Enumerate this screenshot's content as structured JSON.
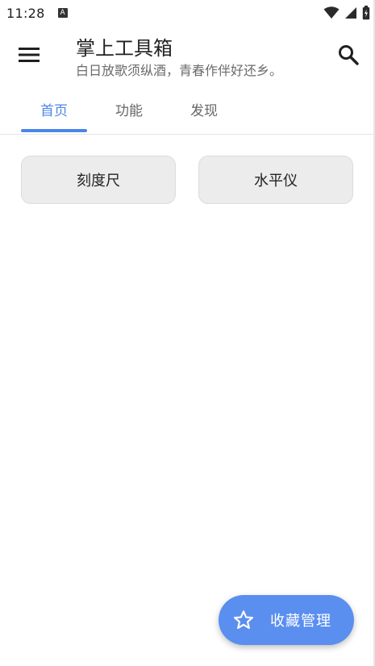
{
  "status_bar": {
    "time": "11:28",
    "notification_glyph": "A"
  },
  "toolbar": {
    "title": "掌上工具箱",
    "subtitle": "白日放歌须纵酒，青春作伴好还乡。",
    "menu_icon": "hamburger-menu-icon",
    "search_icon": "search-icon"
  },
  "tabs": [
    {
      "label": "首页",
      "active": true
    },
    {
      "label": "功能",
      "active": false
    },
    {
      "label": "发现",
      "active": false
    }
  ],
  "tools": [
    {
      "label": "刻度尺"
    },
    {
      "label": "水平仪"
    }
  ],
  "fab": {
    "label": "收藏管理",
    "icon": "star-outline-icon"
  },
  "colors": {
    "accent": "#4a86e8",
    "fab": "#5a8ff0",
    "button_bg": "#ececec"
  }
}
